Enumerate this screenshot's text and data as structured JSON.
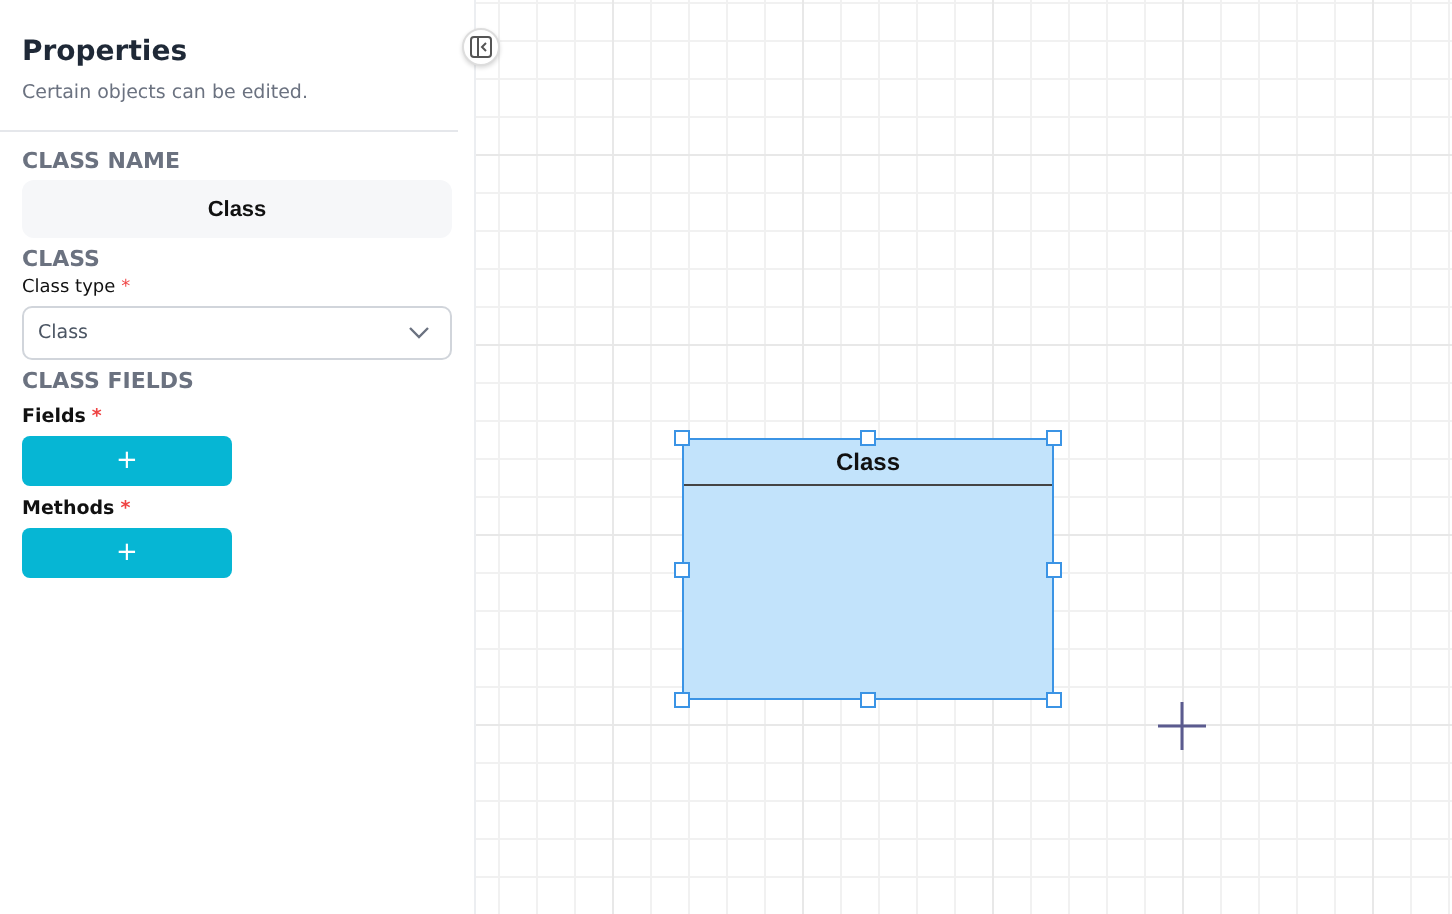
{
  "panel": {
    "title": "Properties",
    "subtitle": "Certain objects can be edited."
  },
  "class_name": {
    "heading": "CLASS NAME",
    "value": "Class"
  },
  "class_section": {
    "heading": "CLASS",
    "label": "Class type",
    "required_mark": "*",
    "value": "Class"
  },
  "fields_section": {
    "heading": "CLASS FIELDS",
    "groups": [
      {
        "label": "Fields",
        "required_mark": "*",
        "button": "+"
      },
      {
        "label": "Methods",
        "required_mark": "*",
        "button": "+"
      }
    ]
  },
  "canvas": {
    "node": {
      "title": "Class",
      "selected": true
    }
  }
}
